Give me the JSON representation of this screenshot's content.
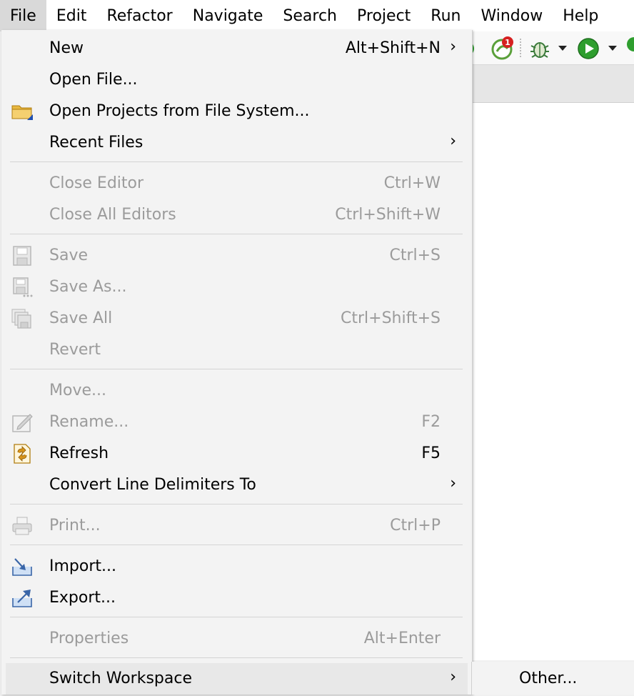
{
  "menubar": [
    "File",
    "Edit",
    "Refactor",
    "Navigate",
    "Search",
    "Project",
    "Run",
    "Window",
    "Help"
  ],
  "badge": "1",
  "menu": {
    "new": {
      "label": "New",
      "accel": "Alt+Shift+N",
      "arrow": "›"
    },
    "open_file": {
      "label": "Open File..."
    },
    "open_projects": {
      "label": "Open Projects from File System..."
    },
    "recent_files": {
      "label": "Recent Files",
      "arrow": "›"
    },
    "close_editor": {
      "label": "Close Editor",
      "accel": "Ctrl+W"
    },
    "close_all": {
      "label": "Close All Editors",
      "accel": "Ctrl+Shift+W"
    },
    "save": {
      "label": "Save",
      "accel": "Ctrl+S"
    },
    "save_as": {
      "label": "Save As..."
    },
    "save_all": {
      "label": "Save All",
      "accel": "Ctrl+Shift+S"
    },
    "revert": {
      "label": "Revert"
    },
    "move": {
      "label": "Move..."
    },
    "rename": {
      "label": "Rename...",
      "accel": "F2"
    },
    "refresh": {
      "label": "Refresh",
      "accel": "F5"
    },
    "convert": {
      "label": "Convert Line Delimiters To",
      "arrow": "›"
    },
    "print": {
      "label": "Print...",
      "accel": "Ctrl+P"
    },
    "import": {
      "label": "Import..."
    },
    "export": {
      "label": "Export..."
    },
    "properties": {
      "label": "Properties",
      "accel": "Alt+Enter"
    },
    "switch_ws": {
      "label": "Switch Workspace",
      "arrow": "›"
    }
  },
  "submenu": {
    "other": "Other..."
  },
  "colors": {
    "run_green": "#2e9e2e",
    "debug_green": "#3a8a3a",
    "badge_red": "#d62020",
    "folder": "#e8b840",
    "disabled": "#9b9b9b"
  },
  "icons": [
    "folder-icon",
    "save-icon",
    "save-as-icon",
    "save-all-icon",
    "rename-icon",
    "refresh-icon",
    "print-icon",
    "import-icon",
    "export-icon",
    "debug-icon",
    "run-icon",
    "spring-icon"
  ]
}
